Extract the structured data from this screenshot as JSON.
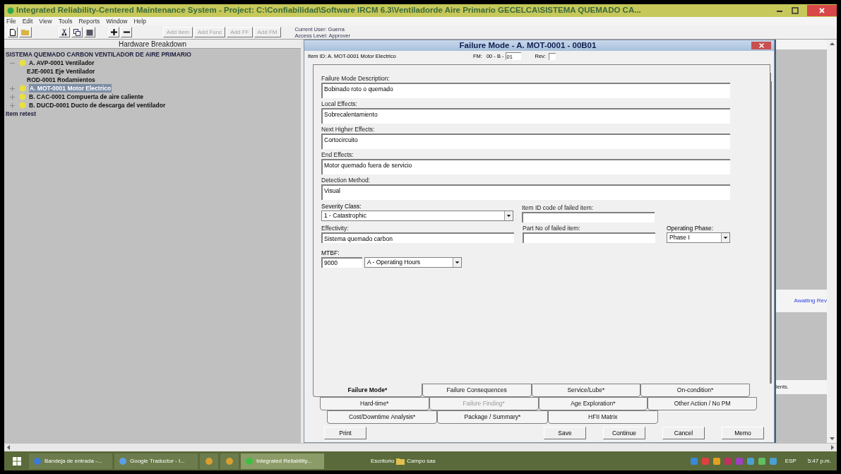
{
  "window": {
    "title": "Integrated Reliability-Centered Maintenance System  -  Project: C:\\Confiabilidad\\Software IRCM 6.3\\Ventiladorde Aire Primario GECELCA\\SISTEMA QUEMADO CA..."
  },
  "menu": [
    "File",
    "Edit",
    "View",
    "Tools",
    "Reports",
    "Window",
    "Help"
  ],
  "toolbar": {
    "add_buttons": [
      {
        "label": "Add Item",
        "disabled": true
      },
      {
        "label": "Add Func",
        "disabled": true
      },
      {
        "label": "Add FF",
        "disabled": true
      },
      {
        "label": "Add FM",
        "disabled": true
      }
    ],
    "current_user": "Current User: Guerra",
    "access_level": "Access Level: Approver"
  },
  "hardware_breakdown": {
    "title": "Hardware Breakdown",
    "tree": [
      {
        "label": "SISTEMA QUEMADO CARBON  VENTILADOR DE AIRE PRIMARIO",
        "selected": false,
        "children": [
          {
            "label": "A. AVP-0001  Ventilador",
            "expanded": true,
            "selected": false,
            "children": [
              {
                "label": "EJE-0001  Eje Ventilador",
                "selected": false
              },
              {
                "label": "ROD-0001  Rodamientos",
                "selected": false
              }
            ]
          },
          {
            "label": "A. MOT-0001  Motor Electrico",
            "expanded": false,
            "selected": true
          },
          {
            "label": "B. CAC-0001  Compuerta de aire caliente",
            "expanded": false,
            "selected": false
          },
          {
            "label": "B. DUCD-0001  Ducto de descarga del ventilador",
            "expanded": false,
            "selected": false
          }
        ]
      },
      {
        "label": "Item retest",
        "selected": false
      }
    ]
  },
  "dialog": {
    "title": "Failure Mode - A. MOT-0001 - 00B01",
    "item_id": "Item ID:  A. MOT-0001 Motor Electrico",
    "fm_label": "FM:",
    "fm_prefix": "00 - B -",
    "fm_value": "01",
    "rev_label": "Rev:",
    "rev_checked": false,
    "text_fields": [
      {
        "label": "Failure Mode Description:",
        "value": "Bobinado roto o quemado"
      },
      {
        "label": "Local Effects:",
        "value": "Sobrecalentamiento"
      },
      {
        "label": "Next Higher Effects:",
        "value": "Cortocircuito"
      },
      {
        "label": "End Effects:",
        "value": "Motor quemado fuera de servicio"
      },
      {
        "label": "Detection Method:",
        "value": "Visual"
      }
    ],
    "severity": {
      "label": "Severity Class:",
      "value": "1 - Catastrophic"
    },
    "item_id_code": {
      "label": "Item ID code of failed item:"
    },
    "effectivity": {
      "label": "Effectivity:",
      "value": "Sistema quemado carbon"
    },
    "part_no": {
      "label": "Part No of failed item:"
    },
    "operating_phase": {
      "label": "Operating Phase:",
      "value": "Phase I"
    },
    "mtbf": {
      "label": "MTBF:",
      "value": "9000",
      "unit": "A - Operating Hours"
    },
    "tab_rows": [
      [
        {
          "label": "Failure Mode*",
          "selected": true,
          "disabled": false
        },
        {
          "label": "Failure Consequences",
          "selected": false,
          "disabled": false
        },
        {
          "label": "Service/Lube*",
          "selected": false,
          "disabled": false
        },
        {
          "label": "On-condition*",
          "selected": false,
          "disabled": false
        }
      ],
      [
        {
          "label": "Hard-time*",
          "selected": false,
          "disabled": false
        },
        {
          "label": "Failure Finding*",
          "selected": false,
          "disabled": true
        },
        {
          "label": "Age Exploration*",
          "selected": false,
          "disabled": false
        },
        {
          "label": "Other Action / No PM",
          "selected": false,
          "disabled": false
        }
      ],
      [
        {
          "label": "Cost/Downtime Analysis*",
          "selected": false,
          "disabled": false
        },
        {
          "label": "Package / Summary*",
          "selected": false,
          "disabled": false
        },
        {
          "label": "HFII Matrix",
          "selected": false,
          "disabled": false
        }
      ]
    ],
    "buttons_left": [
      "Print"
    ],
    "buttons_right": [
      "Save",
      "Continue",
      "Cancel",
      "Memo"
    ]
  },
  "right_panel": {
    "status": "Awaiting Rev",
    "note": "ients."
  },
  "taskbar": {
    "items": [
      {
        "label": "Bandeja de entrada -...",
        "kind": "mail",
        "active": false
      },
      {
        "label": "Google Traductor - I...",
        "kind": "browser",
        "active": false
      },
      {
        "kind": "app",
        "active": false
      },
      {
        "kind": "app",
        "active": false
      },
      {
        "label": "Integrated Reliability...",
        "kind": "ircm",
        "active": true
      }
    ],
    "toolbar_label": "Escritorio",
    "folder": "Campo sas",
    "language": "ESP",
    "clock": "5:47 p.m."
  }
}
